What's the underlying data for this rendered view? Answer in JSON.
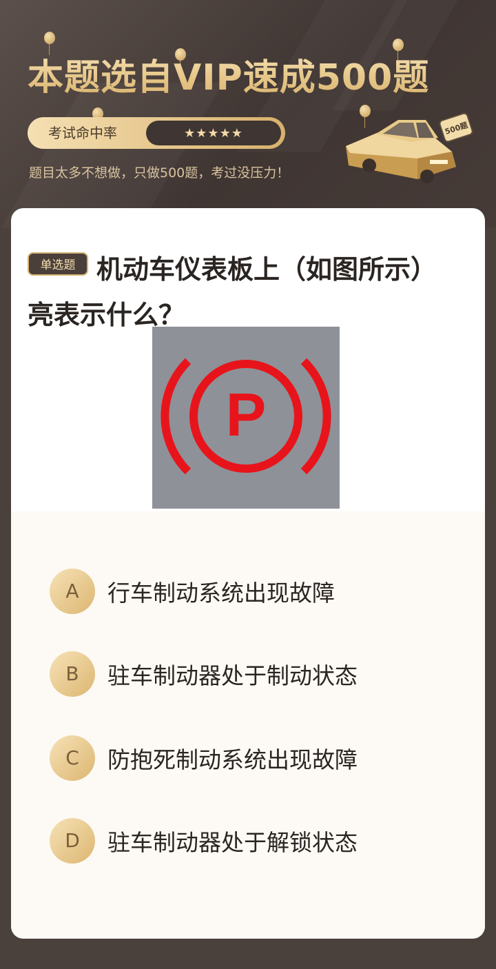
{
  "header": {
    "title": "本题选自VIP速成500题",
    "rate_label": "考试命中率",
    "stars": "★★★★★",
    "subline": "题目太多不想做，只做500题，考过没压力！",
    "car_badge": "500题"
  },
  "question": {
    "type_tag": "单选题",
    "text": "机动车仪表板上（如图所示）亮表示什么？",
    "image_symbol": "P",
    "image_icon": "parking-brake-warning-icon"
  },
  "options": [
    {
      "letter": "A",
      "text": "行车制动系统出现故障"
    },
    {
      "letter": "B",
      "text": "驻车制动器处于制动状态"
    },
    {
      "letter": "C",
      "text": "防抱死制动系统出现故障"
    },
    {
      "letter": "D",
      "text": "驻车制动器处于解锁状态"
    }
  ],
  "colors": {
    "background": "#4a403c",
    "gold": "#d9b26b",
    "card": "#ffffff",
    "warning_red": "#e8141b"
  }
}
